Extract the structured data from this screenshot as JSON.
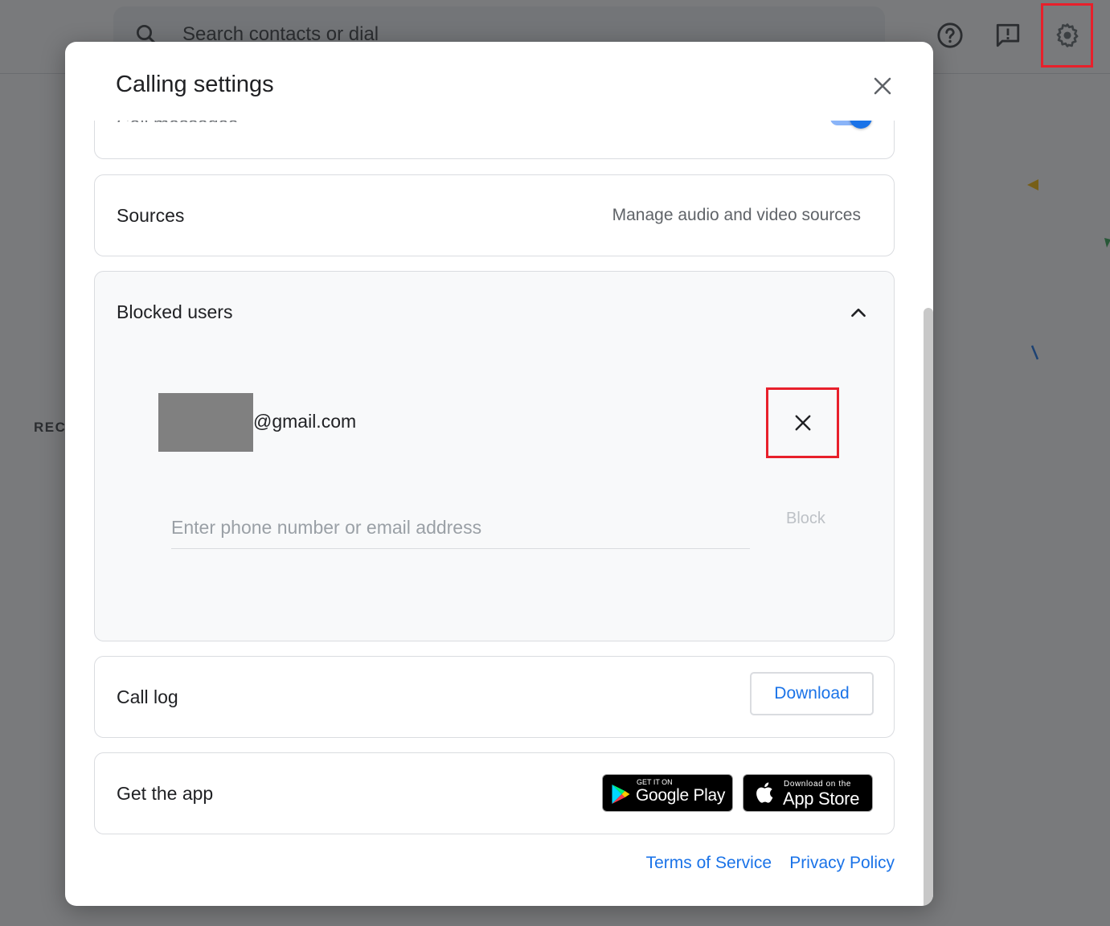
{
  "app": {
    "search_placeholder": "Search contacts or dial",
    "section_label_partial": "REC",
    "header_icons": [
      "help-icon",
      "feedback-icon",
      "gear-icon"
    ]
  },
  "dialog": {
    "title": "Calling settings",
    "close_icon": "close-icon",
    "partial_card": {
      "label_partial": "Call messages",
      "toggle_on": true
    },
    "sources": {
      "label": "Sources",
      "action": "Manage audio and video sources"
    },
    "blocked_users": {
      "label": "Blocked users",
      "expanded": true,
      "entries": [
        {
          "email_suffix": "@gmail.com",
          "redacted": true
        }
      ],
      "input_placeholder": "Enter phone number or email address",
      "input_value": "",
      "block_label": "Block"
    },
    "call_log": {
      "label": "Call log",
      "download_label": "Download"
    },
    "get_app": {
      "label": "Get the app",
      "google_play": {
        "small": "GET IT ON",
        "big": "Google Play"
      },
      "app_store": {
        "small": "Download on the",
        "big": "App Store"
      }
    },
    "footer": {
      "terms": "Terms of Service",
      "privacy": "Privacy Policy"
    }
  },
  "colors": {
    "accent": "#1a73e8",
    "highlight": "#e8202b",
    "scrim": "rgba(32,33,36,0.6)"
  }
}
